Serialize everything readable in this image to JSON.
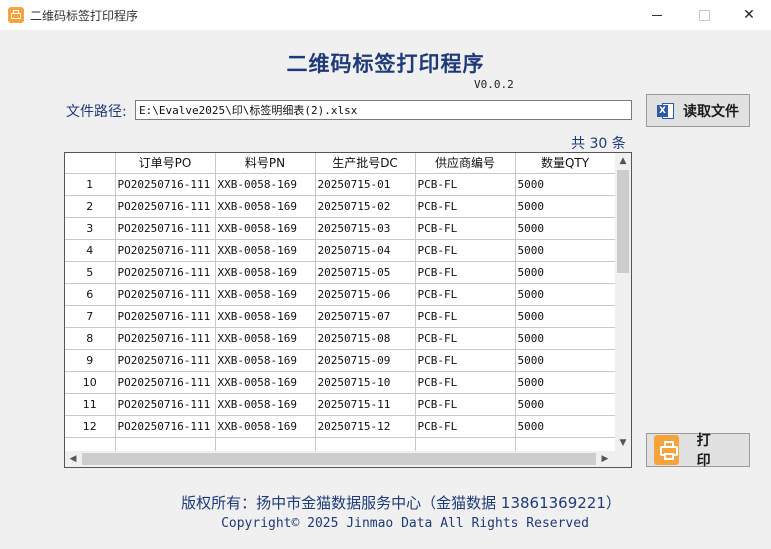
{
  "window": {
    "title": "二维码标签打印程序",
    "min_glyph": "",
    "close_glyph": "✕"
  },
  "header": {
    "title": "二维码标签打印程序",
    "version": "V0.0.2"
  },
  "file": {
    "label": "文件路径:",
    "path": "E:\\Evalve2025\\印\\标签明细表(2).xlsx"
  },
  "read_button": {
    "icon_letter": "X",
    "label": "读取文件"
  },
  "count_text": "共 30 条",
  "table": {
    "columns": [
      "",
      "订单号PO",
      "料号PN",
      "生产批号DC",
      "供应商编号",
      "数量QTY"
    ],
    "rows": [
      [
        "1",
        "PO20250716-111",
        "XXB-0058-169",
        "20250715-01",
        "PCB-FL",
        "5000"
      ],
      [
        "2",
        "PO20250716-111",
        "XXB-0058-169",
        "20250715-02",
        "PCB-FL",
        "5000"
      ],
      [
        "3",
        "PO20250716-111",
        "XXB-0058-169",
        "20250715-03",
        "PCB-FL",
        "5000"
      ],
      [
        "4",
        "PO20250716-111",
        "XXB-0058-169",
        "20250715-04",
        "PCB-FL",
        "5000"
      ],
      [
        "5",
        "PO20250716-111",
        "XXB-0058-169",
        "20250715-05",
        "PCB-FL",
        "5000"
      ],
      [
        "6",
        "PO20250716-111",
        "XXB-0058-169",
        "20250715-06",
        "PCB-FL",
        "5000"
      ],
      [
        "7",
        "PO20250716-111",
        "XXB-0058-169",
        "20250715-07",
        "PCB-FL",
        "5000"
      ],
      [
        "8",
        "PO20250716-111",
        "XXB-0058-169",
        "20250715-08",
        "PCB-FL",
        "5000"
      ],
      [
        "9",
        "PO20250716-111",
        "XXB-0058-169",
        "20250715-09",
        "PCB-FL",
        "5000"
      ],
      [
        "10",
        "PO20250716-111",
        "XXB-0058-169",
        "20250715-10",
        "PCB-FL",
        "5000"
      ],
      [
        "11",
        "PO20250716-111",
        "XXB-0058-169",
        "20250715-11",
        "PCB-FL",
        "5000"
      ],
      [
        "12",
        "PO20250716-111",
        "XXB-0058-169",
        "20250715-12",
        "PCB-FL",
        "5000"
      ],
      [
        "",
        "",
        "",
        "",
        "",
        ""
      ]
    ]
  },
  "scroll": {
    "up": "▲",
    "down": "▼",
    "left": "◀",
    "right": "▶"
  },
  "print_button": {
    "label": "打印"
  },
  "footer": {
    "copyright_cn": "版权所有：扬中市金猫数据服务中心（金猫数据 13861369221）",
    "copyright_en": "Copyright© 2025 Jinmao Data All Rights Reserved"
  },
  "colors": {
    "accent": "#1f3a7a",
    "icon_orange": "#f5a33a",
    "excel_blue": "#2a5aa8"
  }
}
